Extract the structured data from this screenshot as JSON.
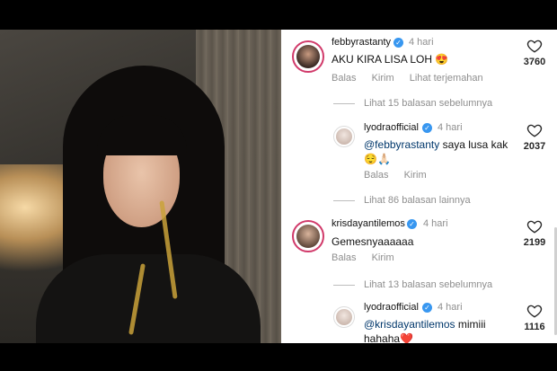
{
  "comments": [
    {
      "username": "febbyrastanty",
      "time": "4 hari",
      "text": "AKU KIRA LISA LOH",
      "emoji": "😍",
      "actions": [
        "Balas",
        "Kirim",
        "Lihat terjemahan"
      ],
      "likes": "3760"
    },
    {
      "username": "lyodraofficial",
      "time": "4 hari",
      "mention": "@febbyrastanty",
      "text": " saya lusa kak",
      "emoji": "😌🙏🏻",
      "actions": [
        "Balas",
        "Kirim"
      ],
      "likes": "2037"
    },
    {
      "username": "krisdayantilemos",
      "time": "4 hari",
      "text": "Gemesnyaaaaaa",
      "actions": [
        "Balas",
        "Kirim"
      ],
      "likes": "2199"
    },
    {
      "username": "lyodraofficial",
      "time": "4 hari",
      "mention": "@krisdayantilemos",
      "text": " mimiii",
      "text2": "hahaha",
      "emoji": "❤️",
      "likes": "1116"
    }
  ],
  "replies": [
    "Lihat 15 balasan sebelumnya",
    "Lihat 86 balasan lainnya",
    "Lihat 13 balasan sebelumnya"
  ],
  "colors": {
    "verified": "#3897f0",
    "ring": "#d13a6a",
    "heart_emoji": "#e0245e"
  }
}
